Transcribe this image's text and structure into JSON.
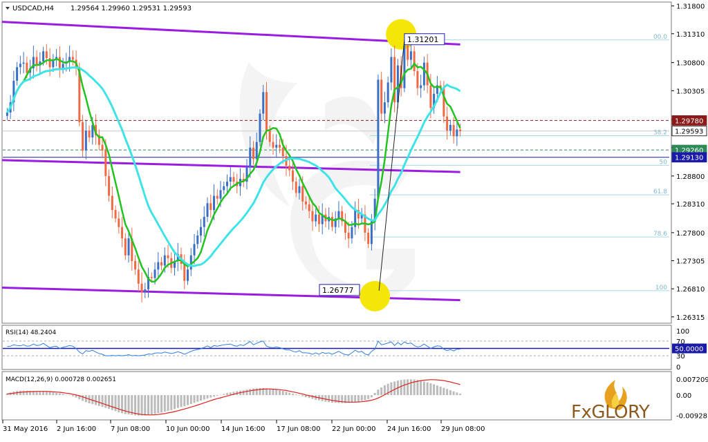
{
  "chart_data": {
    "type": "candlestick",
    "symbol_header": "USDCAD,H4",
    "ohlc_header": "1.29564 1.29960 1.29531 1.29593",
    "price_axis": {
      "ylim": [
        1.26215,
        1.31856
      ],
      "ticks": [
        "1.31800",
        "1.31310",
        "1.30800",
        "1.30305",
        "1.29795",
        "1.29305",
        "1.28800",
        "1.28310",
        "1.27800",
        "1.27305",
        "1.26810",
        "1.26315"
      ]
    },
    "time_axis_labels": [
      "31 May 2016",
      "2 Jun 16:00",
      "7 Jun 08:00",
      "10 Jun 00:00",
      "14 Jun 16:00",
      "17 Jun 08:00",
      "22 Jun 00:00",
      "24 Jun 16:00",
      "29 Jun 08:00"
    ],
    "price_levels": [
      {
        "label": "1.29780",
        "value": 1.2978,
        "color": "#8b1a1a",
        "style": "dashed"
      },
      {
        "label": "1.29593",
        "value": 1.29593,
        "color": "#000000",
        "style": "solid"
      },
      {
        "label": "1.29260",
        "value": 1.2926,
        "color": "#2e8b57",
        "style": "dashed"
      },
      {
        "label": "1.29130",
        "value": 1.2913,
        "color": "#1a1aa6",
        "style": "solid"
      }
    ],
    "fibonacci": {
      "high": 1.31201,
      "low": 1.26777,
      "levels": [
        {
          "label": "00.0",
          "value": 1.31201
        },
        {
          "label": "38.2",
          "value": 1.29511
        },
        {
          "label": "50",
          "value": 1.28989
        },
        {
          "label": "61.8",
          "value": 1.28467
        },
        {
          "label": "78.6",
          "value": 1.27724
        },
        {
          "label": "100",
          "value": 1.26777
        }
      ]
    },
    "callouts": [
      {
        "label": "1.31201",
        "value": 1.31201
      },
      {
        "label": "1.26777",
        "value": 1.26777
      }
    ],
    "channel_lines": [
      {
        "name": "upper",
        "from": 1.3152,
        "to": 1.3112
      },
      {
        "name": "middle",
        "from": 1.2908,
        "to": 1.2887
      },
      {
        "name": "lower",
        "from": 1.2683,
        "to": 1.2661
      }
    ],
    "close_series": [
      1.2992,
      1.301,
      1.3048,
      1.3072,
      1.3078,
      1.308,
      1.3062,
      1.307,
      1.309,
      1.3075,
      1.3082,
      1.31,
      1.3088,
      1.3072,
      1.3086,
      1.309,
      1.307,
      1.3078,
      1.3082,
      1.309,
      1.3085,
      1.3072,
      1.2975,
      1.2925,
      1.296,
      1.2948,
      1.297,
      1.2952,
      1.2935,
      1.2925,
      1.288,
      1.2845,
      1.282,
      1.2805,
      1.279,
      1.277,
      1.274,
      1.277,
      1.273,
      1.2715,
      1.269,
      1.2675,
      1.268,
      1.2702,
      1.27,
      1.2715,
      1.2728,
      1.2722,
      1.274,
      1.2735,
      1.2718,
      1.273,
      1.2742,
      1.2725,
      1.2695,
      1.2715,
      1.274,
      1.276,
      1.2775,
      1.279,
      1.2808,
      1.2832,
      1.282,
      1.2845,
      1.284,
      1.2855,
      1.2862,
      1.287,
      1.2878,
      1.287,
      1.2862,
      1.2875,
      1.287,
      1.2895,
      1.293,
      1.291,
      1.294,
      1.299,
      1.3028,
      1.296,
      1.294,
      1.293,
      1.2935,
      1.293,
      1.2915,
      1.2898,
      1.289,
      1.287,
      1.285,
      1.2862,
      1.2835,
      1.283,
      1.2818,
      1.28,
      1.2812,
      1.2795,
      1.2812,
      1.28,
      1.2808,
      1.279,
      1.2805,
      1.2818,
      1.28,
      1.278,
      1.277,
      1.279,
      1.282,
      1.2805,
      1.2812,
      1.278,
      1.276,
      1.28,
      1.284,
      1.305,
      1.299,
      1.301,
      1.3045,
      1.309,
      1.301,
      1.3075,
      1.3035,
      1.311,
      1.3085,
      1.31,
      1.3065,
      1.3035,
      1.304,
      1.308,
      1.304,
      1.3,
      1.3025,
      1.304,
      1.3035,
      1.2985,
      1.296,
      1.297,
      1.295,
      1.2962,
      1.2959
    ],
    "ma_series": [
      {
        "name": "fast MA",
        "color": "#22c31f"
      },
      {
        "name": "slow MA",
        "color": "#3fe3e6"
      }
    ],
    "rsi": {
      "label": "RSI(14) 48.2404",
      "ylim": [
        0,
        100
      ],
      "ticks": [
        "100",
        "70",
        "50.0000",
        "30",
        "0"
      ],
      "level": 50,
      "values": [
        55,
        56,
        60,
        58,
        57,
        60,
        56,
        57,
        62,
        58,
        59,
        64,
        58,
        52,
        55,
        56,
        50,
        53,
        55,
        58,
        56,
        50,
        40,
        35,
        44,
        42,
        45,
        40,
        36,
        34,
        30,
        30,
        31,
        30,
        31,
        30,
        31,
        33,
        30,
        31,
        30,
        31,
        32,
        35,
        34,
        37,
        38,
        37,
        40,
        38,
        36,
        38,
        41,
        38,
        34,
        38,
        42,
        45,
        47,
        49,
        53,
        57,
        52,
        58,
        56,
        58,
        60,
        61,
        62,
        58,
        56,
        60,
        58,
        63,
        69,
        60,
        64,
        68,
        70,
        56,
        53,
        52,
        54,
        52,
        49,
        46,
        46,
        42,
        40,
        44,
        38,
        38,
        37,
        34,
        38,
        34,
        39,
        36,
        38,
        34,
        38,
        42,
        37,
        33,
        32,
        38,
        45,
        40,
        42,
        35,
        32,
        42,
        48,
        70,
        60,
        62,
        65,
        68,
        58,
        66,
        60,
        68,
        63,
        65,
        58,
        54,
        56,
        62,
        56,
        50,
        54,
        57,
        56,
        48,
        44,
        47,
        43,
        48,
        48
      ]
    },
    "macd": {
      "label": "MACD(12,26,9) 0.000728 0.002651",
      "ticks": [
        "0.007209",
        "0.00",
        "-0.009287"
      ],
      "ylim": [
        -0.01,
        0.0082
      ],
      "histogram": [
        0.0008,
        0.0012,
        0.0016,
        0.0019,
        0.002,
        0.0021,
        0.002,
        0.0019,
        0.0019,
        0.0018,
        0.0017,
        0.0018,
        0.0016,
        0.0014,
        0.0012,
        0.001,
        0.0008,
        0.0005,
        0.0002,
        0,
        -0.0005,
        -0.0011,
        -0.0019,
        -0.0026,
        -0.0032,
        -0.0037,
        -0.0041,
        -0.0045,
        -0.0049,
        -0.0053,
        -0.0058,
        -0.0063,
        -0.0068,
        -0.0073,
        -0.0078,
        -0.0082,
        -0.0086,
        -0.0088,
        -0.009,
        -0.0092,
        -0.0093,
        -0.0093,
        -0.0092,
        -0.009,
        -0.0088,
        -0.0085,
        -0.0082,
        -0.0079,
        -0.0075,
        -0.0071,
        -0.0068,
        -0.0063,
        -0.0058,
        -0.0054,
        -0.005,
        -0.0045,
        -0.004,
        -0.0035,
        -0.003,
        -0.0025,
        -0.002,
        -0.0015,
        -0.0011,
        -0.0007,
        -0.0003,
        0.0001,
        0.0005,
        0.0009,
        0.0012,
        0.0015,
        0.0018,
        0.002,
        0.0022,
        0.0025,
        0.0028,
        0.003,
        0.0031,
        0.0032,
        0.0032,
        0.0031,
        0.0029,
        0.0027,
        0.0025,
        0.0022,
        0.0019,
        0.0015,
        0.0011,
        0.0007,
        0.0003,
        -0.0001,
        -0.0005,
        -0.0009,
        -0.0013,
        -0.0017,
        -0.0021,
        -0.0024,
        -0.0027,
        -0.003,
        -0.0032,
        -0.0034,
        -0.0035,
        -0.0036,
        -0.0036,
        -0.0036,
        -0.0035,
        -0.0033,
        -0.0031,
        -0.0029,
        -0.0026,
        -0.0023,
        -0.0018,
        -0.001,
        0.001,
        0.0025,
        0.0035,
        0.0045,
        0.0052,
        0.0058,
        0.0062,
        0.0066,
        0.0069,
        0.0071,
        0.0072,
        0.0072,
        0.0071,
        0.0069,
        0.0066,
        0.0062,
        0.0058,
        0.0054,
        0.0049,
        0.0044,
        0.0039,
        0.0033,
        0.0028,
        0.0022,
        0.0017,
        0.0012,
        0.0007
      ],
      "signal": [
        0.0005,
        0.0007,
        0.0009,
        0.0011,
        0.0013,
        0.0014,
        0.0015,
        0.0016,
        0.0016,
        0.0017,
        0.0017,
        0.0017,
        0.0017,
        0.0016,
        0.0015,
        0.0014,
        0.0013,
        0.0011,
        0.0009,
        0.0007,
        0.0004,
        0.0001,
        -0.0003,
        -0.0008,
        -0.0013,
        -0.0018,
        -0.0023,
        -0.0028,
        -0.0033,
        -0.0038,
        -0.0043,
        -0.0048,
        -0.0053,
        -0.0058,
        -0.0063,
        -0.0068,
        -0.0072,
        -0.0076,
        -0.008,
        -0.0083,
        -0.0086,
        -0.0088,
        -0.0089,
        -0.009,
        -0.009,
        -0.0089,
        -0.0088,
        -0.0086,
        -0.0084,
        -0.0081,
        -0.0078,
        -0.0075,
        -0.0071,
        -0.0067,
        -0.0063,
        -0.0059,
        -0.0054,
        -0.005,
        -0.0045,
        -0.004,
        -0.0035,
        -0.003,
        -0.0025,
        -0.002,
        -0.0016,
        -0.0012,
        -0.0008,
        -0.0004,
        0,
        0.0004,
        0.0008,
        0.0011,
        0.0014,
        0.0017,
        0.002,
        0.0022,
        0.0024,
        0.0026,
        0.0027,
        0.0028,
        0.0028,
        0.0027,
        0.0026,
        0.0025,
        0.0023,
        0.0021,
        0.0018,
        0.0015,
        0.0012,
        0.0008,
        0.0005,
        0.0001,
        -0.0002,
        -0.0006,
        -0.0009,
        -0.0012,
        -0.0015,
        -0.0018,
        -0.0021,
        -0.0024,
        -0.0026,
        -0.0028,
        -0.003,
        -0.0031,
        -0.0032,
        -0.0032,
        -0.0032,
        -0.0031,
        -0.003,
        -0.0028,
        -0.0026,
        -0.0023,
        -0.0019,
        -0.0013,
        -0.0006,
        0.0002,
        0.001,
        0.0018,
        0.0026,
        0.0033,
        0.004,
        0.0046,
        0.0051,
        0.0056,
        0.006,
        0.0063,
        0.0066,
        0.0068,
        0.0069,
        0.007,
        0.007,
        0.0069,
        0.0068,
        0.0066,
        0.0063,
        0.006,
        0.0056,
        0.0052,
        0.0048
      ]
    },
    "colors": {
      "bullish": "#3a6fc4",
      "bearish": "#ef6a44",
      "channel": "#9a1ce0",
      "highlight": "#f5e60a"
    }
  },
  "brand": {
    "text": "FxGLORY"
  }
}
